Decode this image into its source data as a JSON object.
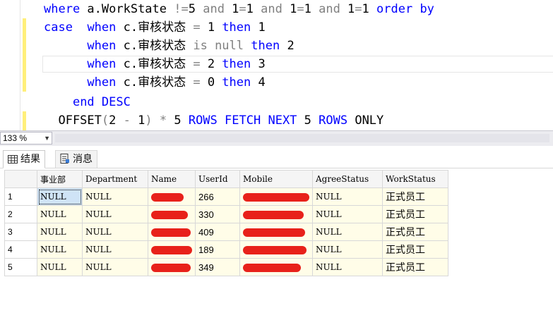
{
  "editor": {
    "lines": [
      {
        "tokens": [
          {
            "t": "where",
            "c": "kw"
          },
          {
            "t": " a.WorkState ",
            "c": ""
          },
          {
            "t": "!=",
            "c": "gray"
          },
          {
            "t": "5 ",
            "c": ""
          },
          {
            "t": "and",
            "c": "gray"
          },
          {
            "t": " 1",
            "c": ""
          },
          {
            "t": "=",
            "c": "gray"
          },
          {
            "t": "1 ",
            "c": ""
          },
          {
            "t": "and",
            "c": "gray"
          },
          {
            "t": " 1",
            "c": ""
          },
          {
            "t": "=",
            "c": "gray"
          },
          {
            "t": "1 ",
            "c": ""
          },
          {
            "t": "and",
            "c": "gray"
          },
          {
            "t": " 1",
            "c": ""
          },
          {
            "t": "=",
            "c": "gray"
          },
          {
            "t": "1 ",
            "c": ""
          },
          {
            "t": "order by",
            "c": "kw"
          }
        ]
      },
      {
        "tokens": [
          {
            "t": "case",
            "c": "kw"
          },
          {
            "t": "  ",
            "c": ""
          },
          {
            "t": "when",
            "c": "kw"
          },
          {
            "t": " c.审核状态 ",
            "c": ""
          },
          {
            "t": "=",
            "c": "gray"
          },
          {
            "t": " 1 ",
            "c": ""
          },
          {
            "t": "then",
            "c": "kw"
          },
          {
            "t": " 1",
            "c": ""
          }
        ]
      },
      {
        "tokens": [
          {
            "t": "      ",
            "c": ""
          },
          {
            "t": "when",
            "c": "kw"
          },
          {
            "t": " c.审核状态 ",
            "c": ""
          },
          {
            "t": "is",
            "c": "gray"
          },
          {
            "t": " ",
            "c": ""
          },
          {
            "t": "null",
            "c": "gray"
          },
          {
            "t": " ",
            "c": ""
          },
          {
            "t": "then",
            "c": "kw"
          },
          {
            "t": " 2",
            "c": ""
          }
        ]
      },
      {
        "tokens": [
          {
            "t": "      ",
            "c": ""
          },
          {
            "t": "when",
            "c": "kw"
          },
          {
            "t": " c.审核状态 ",
            "c": ""
          },
          {
            "t": "=",
            "c": "gray"
          },
          {
            "t": " 2 ",
            "c": ""
          },
          {
            "t": "then",
            "c": "kw"
          },
          {
            "t": " 3",
            "c": ""
          }
        ]
      },
      {
        "tokens": [
          {
            "t": "      ",
            "c": ""
          },
          {
            "t": "when",
            "c": "kw"
          },
          {
            "t": " c.审核状态 ",
            "c": ""
          },
          {
            "t": "=",
            "c": "gray"
          },
          {
            "t": " 0 ",
            "c": ""
          },
          {
            "t": "then",
            "c": "kw"
          },
          {
            "t": " 4",
            "c": ""
          }
        ]
      },
      {
        "tokens": [
          {
            "t": "    ",
            "c": ""
          },
          {
            "t": "end",
            "c": "kw"
          },
          {
            "t": " ",
            "c": ""
          },
          {
            "t": "DESC",
            "c": "kw"
          }
        ]
      },
      {
        "tokens": [
          {
            "t": "  OFFSET",
            "c": ""
          },
          {
            "t": "(",
            "c": "gray"
          },
          {
            "t": "2 ",
            "c": ""
          },
          {
            "t": "-",
            "c": "gray"
          },
          {
            "t": " 1",
            "c": ""
          },
          {
            "t": ")",
            "c": "gray"
          },
          {
            "t": " ",
            "c": ""
          },
          {
            "t": "*",
            "c": "gray"
          },
          {
            "t": " 5 ",
            "c": ""
          },
          {
            "t": "ROWS",
            "c": "kw"
          },
          {
            "t": " ",
            "c": ""
          },
          {
            "t": "FETCH",
            "c": "kw"
          },
          {
            "t": " ",
            "c": ""
          },
          {
            "t": "NEXT",
            "c": "kw"
          },
          {
            "t": " 5 ",
            "c": ""
          },
          {
            "t": "ROWS",
            "c": "kw"
          },
          {
            "t": " ONLY",
            "c": ""
          }
        ]
      }
    ]
  },
  "zoom": {
    "value": "133 %"
  },
  "tabs": {
    "results": "结果",
    "messages": "消息"
  },
  "grid": {
    "columns": [
      "事业部",
      "Department",
      "Name",
      "UserId",
      "Mobile",
      "AgreeStatus",
      "WorkStatus"
    ],
    "rows": [
      {
        "num": "1",
        "dept_unit": "NULL",
        "department": "NULL",
        "name": "",
        "user_id": "266",
        "mobile": "",
        "agree_status": "NULL",
        "work_status": "正式员工"
      },
      {
        "num": "2",
        "dept_unit": "NULL",
        "department": "NULL",
        "name": "",
        "user_id": "330",
        "mobile": "",
        "agree_status": "NULL",
        "work_status": "正式员工"
      },
      {
        "num": "3",
        "dept_unit": "NULL",
        "department": "NULL",
        "name": "",
        "user_id": "409",
        "mobile": "",
        "agree_status": "NULL",
        "work_status": "正式员工"
      },
      {
        "num": "4",
        "dept_unit": "NULL",
        "department": "NULL",
        "name": "",
        "user_id": "189",
        "mobile": "",
        "agree_status": "NULL",
        "work_status": "正式员工"
      },
      {
        "num": "5",
        "dept_unit": "NULL",
        "department": "NULL",
        "name": "",
        "user_id": "349",
        "mobile": "",
        "agree_status": "NULL",
        "work_status": "正式员工"
      }
    ]
  },
  "colors": {
    "keyword": "#0000ff",
    "operator": "#808080",
    "change_bar": "#ffef7a",
    "redaction": "#e8211a",
    "selected_cell": "#cfe3f6"
  }
}
